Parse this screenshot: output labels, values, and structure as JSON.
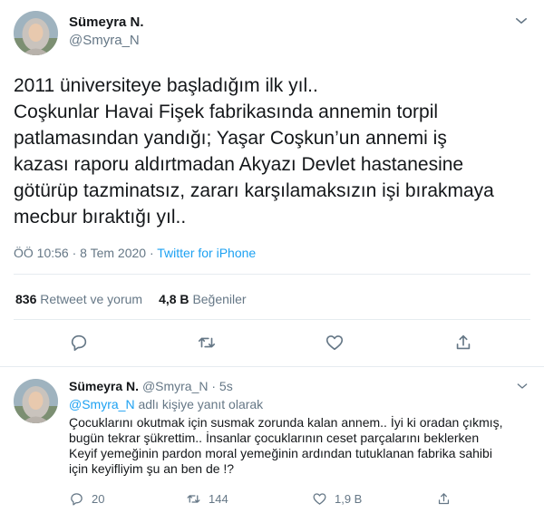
{
  "main_tweet": {
    "author_name": "Sümeyra N.",
    "author_handle": "@Smyra_N",
    "text_lines": [
      "2011 üniversiteye başladığım ilk yıl..",
      "Coşkunlar Havai Fişek fabrikasında annemin torpil",
      "patlamasından yandığı; Yaşar Coşkun’un annemi iş",
      "kazası raporu aldırtmadan Akyazı Devlet hastanesine",
      "götürüp tazminatsız, zararı karşılamaksızın işi bırakmaya",
      "mecbur bıraktığı yıl.."
    ],
    "time": "ÖÖ 10:56 · 8 Tem 2020 · ",
    "source": "Twitter for iPhone",
    "retweets_count": "836",
    "retweets_label": "Retweet ve yorum",
    "likes_count": "4,8 B",
    "likes_label": "Beğeniler"
  },
  "reply_tweet": {
    "author_name": "Sümeyra N.",
    "author_handle": "@Smyra_N · 5s",
    "replying_mention": "@Smyra_N",
    "replying_text": " adlı kişiye yanıt olarak",
    "text_lines": [
      "Çocuklarını okutmak için susmak zorunda kalan annem.. İyi ki oradan çıkmış,",
      "bugün tekrar şükrettim.. İnsanlar çocuklarının ceset parçalarını beklerken",
      "Keyif yemeğinin pardon moral yemeğinin ardından tutuklanan fabrika sahibi",
      "için keyifliyim şu an ben de !?"
    ],
    "reply_count": "20",
    "retweet_count": "144",
    "like_count": "1,9 B"
  },
  "icons": {
    "caret": "chevron-down-icon",
    "reply": "reply-icon",
    "retweet": "retweet-icon",
    "like": "heart-icon",
    "share": "share-icon"
  },
  "colors": {
    "accent": "#1da1f2",
    "muted": "#657786",
    "text": "#14171a",
    "border": "#e6ecf0"
  }
}
